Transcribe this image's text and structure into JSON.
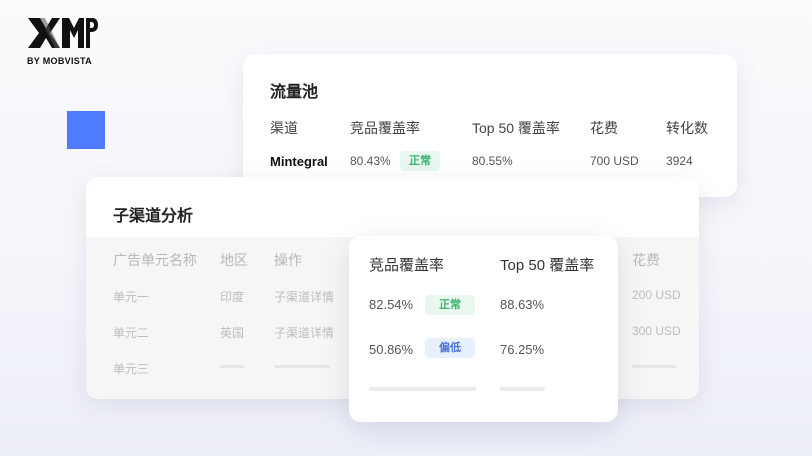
{
  "logo": {
    "mark": "XMP",
    "sub": "BY MOBVISTA"
  },
  "pool_card": {
    "title": "流量池",
    "headers": [
      "渠道",
      "竞品覆盖率",
      "Top 50 覆盖率",
      "花费",
      "转化数"
    ],
    "row": {
      "channel": "Mintegral",
      "competitor_coverage": "80.43%",
      "status": "正常",
      "top50_coverage": "80.55%",
      "spend": "700 USD",
      "conversions": "3924"
    }
  },
  "sub_card": {
    "title": "子渠道分析",
    "headers": [
      "广告单元名称",
      "地区",
      "操作",
      "花费"
    ],
    "rows": [
      {
        "name": "单元一",
        "region": "印度",
        "action": "子渠道详情",
        "spend": "200 USD"
      },
      {
        "name": "单元二",
        "region": "英国",
        "action": "子渠道详情",
        "spend": "300 USD"
      },
      {
        "name": "单元三"
      }
    ]
  },
  "focus_card": {
    "headers": [
      "竞品覆盖率",
      "Top 50 覆盖率"
    ],
    "rows": [
      {
        "competitor_coverage": "82.54%",
        "status": "正常",
        "top50_coverage": "88.63%"
      },
      {
        "competitor_coverage": "50.86%",
        "status": "偏低",
        "top50_coverage": "76.25%"
      }
    ]
  },
  "colors": {
    "accent_square": "#4f7cff",
    "ok": "#3cb371",
    "low": "#4a73d9"
  }
}
